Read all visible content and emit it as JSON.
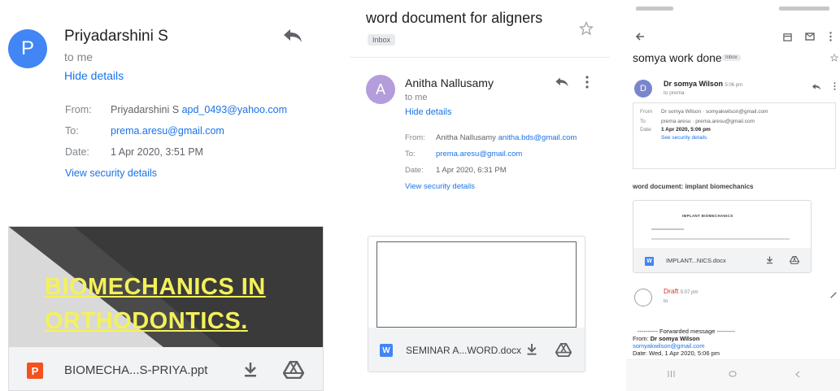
{
  "panel1": {
    "sender_initial": "P",
    "sender_name": "Priyadarshini S",
    "to_line": "to me",
    "hide_details": "Hide details",
    "from_label": "From:",
    "from_name": "Priyadarshini S",
    "from_email": "apd_0493@yahoo.com",
    "to_label": "To:",
    "to_email": "prema.aresu@gmail.com",
    "date_label": "Date:",
    "date_value": "1 Apr 2020, 3:51 PM",
    "security": "View security details",
    "preview_line1": "BIOMECHANICS IN",
    "preview_line2": "ORTHODONTICS.",
    "attachment_type": "P",
    "attachment_name": "BIOMECHA...S-PRIYA.ppt"
  },
  "panel2": {
    "subject": "word document for aligners",
    "label_chip": "Inbox",
    "sender_initial": "A",
    "sender_name": "Anitha Nallusamy",
    "to_line": "to me",
    "hide_details": "Hide details",
    "from_label": "From:",
    "from_name": "Anitha Nallusamy",
    "from_email": "anitha.bds@gmail.com",
    "to_label": "To:",
    "to_email": "prema.aresu@gmail.com",
    "date_label": "Date:",
    "date_value": "1 Apr 2020, 6:31 PM",
    "security": "View security details",
    "attachment_type": "W",
    "attachment_name": "SEMINAR A...WORD.docx"
  },
  "panel3": {
    "subject": "somya work done",
    "label_chip": "Inbox",
    "sender_initial": "D",
    "sender_name": "Dr somya Wilson",
    "sender_time": "5:06 pm",
    "to_line": "to prema",
    "from_label": "From",
    "from_value": "Dr somya Wilson · somyakwilson@gmail.com",
    "to_label": "To",
    "to_value": "prema aresu · prema.aresu@gmail.com",
    "date_label": "Date",
    "date_value": "1 Apr 2020, 5:06 pm",
    "security": "See security details",
    "body_text": "word document: implant biomechanics",
    "doc_heading": "IMPLANT BIOMECHANICS",
    "attachment_type": "W",
    "attachment_name": "IMPLANT...NICS.docx",
    "draft_label": "Draft",
    "draft_time": "5:07 pm",
    "draft_to": "to",
    "forwarded": "---------- Forwarded message ---------",
    "fwd_from_label": "From:",
    "fwd_from_name": "Dr somya Wilson",
    "fwd_email": "somyakwilson@gmail.com",
    "fwd_date": "Date: Wed, 1 Apr 2020, 5:06 pm"
  },
  "colors": {
    "avatar_p": "#4285f4",
    "avatar_a": "#b39ddb",
    "avatar_d": "#7986cb",
    "link": "#1a73e8",
    "ppt_icon": "#f4511e",
    "doc_icon": "#4285f4",
    "preview_text": "#f4f15a"
  }
}
